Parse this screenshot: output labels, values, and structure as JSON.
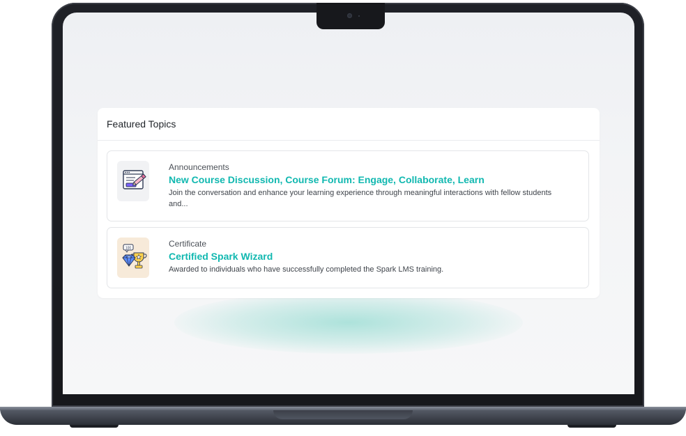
{
  "card": {
    "title": "Featured Topics"
  },
  "topics": [
    {
      "category": "Announcements",
      "title": "New Course Discussion, Course Forum: Engage, Collaborate, Learn",
      "description": "Join the conversation and enhance your learning experience through meaningful interactions with fellow students and...",
      "icon": "announcement-pencil-icon"
    },
    {
      "category": "Certificate",
      "title": "Certified Spark Wizard",
      "description": "Awarded to individuals who have successfully completed the Spark LMS training.",
      "icon": "trophy-diamond-icon"
    }
  ],
  "colors": {
    "accent": "#11b8b0",
    "glow": "#72d2c4",
    "bezel": "#17181c"
  }
}
